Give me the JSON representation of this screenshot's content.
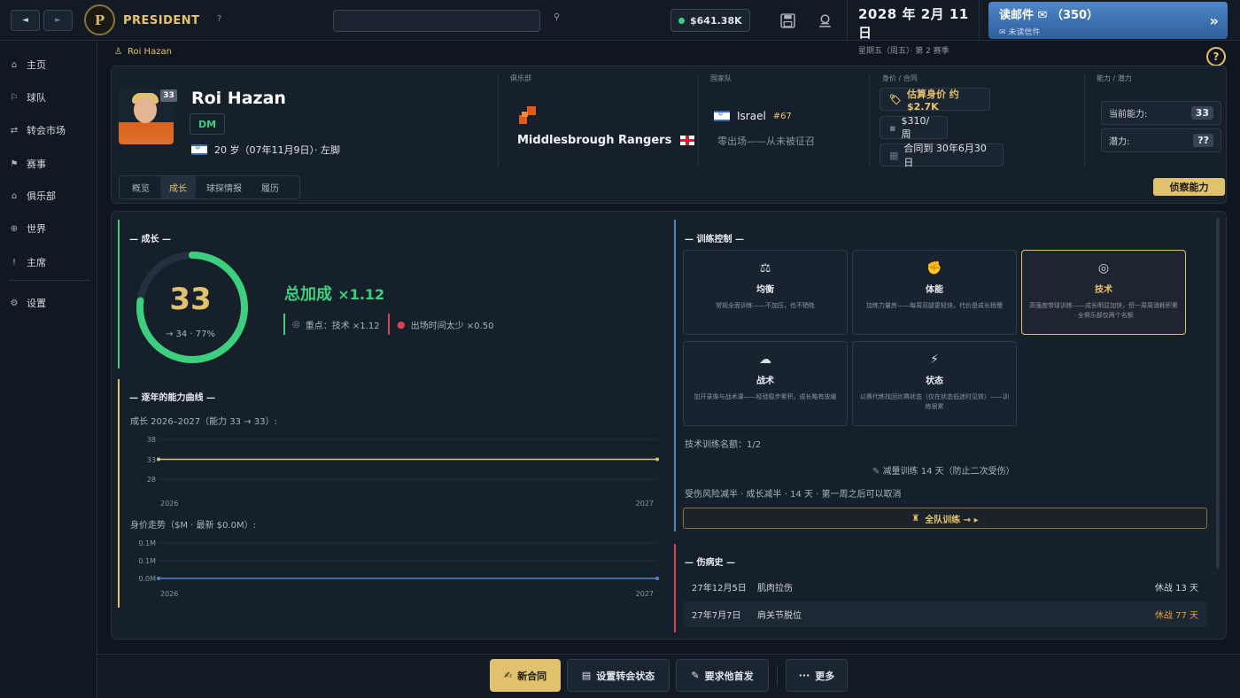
{
  "topbar": {
    "back_icon": "◄",
    "forward_icon": "►",
    "logo_letter": "P",
    "logo_text": "PRESIDENT",
    "help": "?",
    "money": "$641.38K",
    "date": "2028 年 2月 11 日",
    "date_sub": "星期五（周五）· 第 2 赛季",
    "mail_label": "读邮件 ✉ （350）",
    "mail_sub": "✉ 未读信件",
    "mail_arrow": "»"
  },
  "sidebar": {
    "items": [
      {
        "label": "主页",
        "icon": "⌂"
      },
      {
        "label": "球队",
        "icon": "⚐"
      },
      {
        "label": "转会市场",
        "icon": "⇄"
      },
      {
        "label": "赛事",
        "icon": "⚑"
      },
      {
        "label": "俱乐部",
        "icon": "⌂"
      },
      {
        "label": "世界",
        "icon": "⊕"
      },
      {
        "label": "主席",
        "icon": "!"
      },
      {
        "label": "设置",
        "icon": "⚙"
      }
    ]
  },
  "breadcrumb": {
    "icon": "♙",
    "name": "Roi Hazan"
  },
  "player": {
    "number": "33",
    "name": "Roi Hazan",
    "position": "DM",
    "age_text": "20 岁（07年11月9日）· 左脚",
    "club_label": "俱乐部",
    "club_name": "Middlesbrough Rangers",
    "nat_label": "国家队",
    "nat_name": "Israel",
    "nat_rank": "#67",
    "nat_sub": "零出场——从未被征召",
    "value_label": "身价 / 合同",
    "value": "估算身价 约$2.7K",
    "wage": "$310/周",
    "contract": "合同到 30年6月30日",
    "ability_label": "能力 / 潜力",
    "current_ability_label": "当前能力:",
    "current_ability": "33",
    "potential_label": "潜力:",
    "potential": "??"
  },
  "tabs": [
    "概览",
    "成长",
    "球探情报",
    "履历"
  ],
  "scout_button": "侦察能力",
  "growth": {
    "title": "— 成长 —",
    "ring_value": "33",
    "ring_progress": 0.77,
    "ring_sub": "→ 34 · 77%",
    "total_label": "总加成 ",
    "total_mult": "×1.12",
    "focus": "重点：技术 ×1.12",
    "playtime": "出场时间太少 ×0.50"
  },
  "curve": {
    "title": "— 逐年的能力曲线 —",
    "ability_caption": "成长 2026–2027（能力 33 → 33）:",
    "value_caption": "身价走势（$M · 最新 $0.0M）:"
  },
  "chart_data": [
    {
      "type": "line",
      "title": "",
      "x": [
        "2026",
        "2027"
      ],
      "series": [
        {
          "values": [
            33,
            33
          ]
        }
      ],
      "yticks": [
        "38",
        "33",
        "28"
      ],
      "ylim": [
        28,
        38
      ],
      "color": "#e2c16e"
    },
    {
      "type": "line",
      "title": "",
      "x": [
        "2026",
        "2027"
      ],
      "series": [
        {
          "values": [
            0.0,
            0.0
          ]
        }
      ],
      "yticks": [
        "0.1M",
        "0.1M",
        "0.0M"
      ],
      "ylim": [
        0,
        0.1
      ],
      "color": "#4f86c8"
    }
  ],
  "training": {
    "title": "— 训练控制 —",
    "cards": [
      {
        "icon": "⚖",
        "title": "均衡",
        "desc": "常规全面训练——不加压，也不牺牲"
      },
      {
        "icon": "✊",
        "title": "体能",
        "desc": "加练力量房——每周双腿更轻快，代价是成长稍慢"
      },
      {
        "icon": "◎",
        "title": "技术",
        "desc": "高强度带球训练——成长明显加快，但一周周消耗积累 · 全俱乐部仅两个名额"
      },
      {
        "icon": "☁",
        "title": "战术",
        "desc": "加开录像与战术课——经验稳步累积，成长略有放缓"
      },
      {
        "icon": "⚡",
        "title": "状态",
        "desc": "以赛代练找回比赛状态（仅在状态低迷时见效）——训练很累"
      }
    ],
    "slots": "技术训练名额：1/2",
    "rehab": "减量训练 14 天（防止二次受伤）",
    "risk": "受伤风险减半 · 成长减半 · 14 天 · 第一周之后可以取消",
    "team_button": "全队训练 → ▸"
  },
  "injuries": {
    "title": "— 伤病史 —",
    "rows": [
      {
        "date": "27年12月5日",
        "type": "肌肉拉伤",
        "out": "休战 13 天",
        "color": "#cdd4dc"
      },
      {
        "date": "27年7月7日",
        "type": "肩关节脱位",
        "out": "休战 77 天",
        "color": "#e7a03c"
      }
    ]
  },
  "bottom": {
    "contract": "新合同",
    "transfer": "设置转会状态",
    "start": "要求他首发",
    "more": "更多"
  },
  "colors": {
    "accent_gold": "#e2c16e",
    "green": "#3ccf7e",
    "blue": "#4f86c8",
    "red": "#d9434e"
  }
}
